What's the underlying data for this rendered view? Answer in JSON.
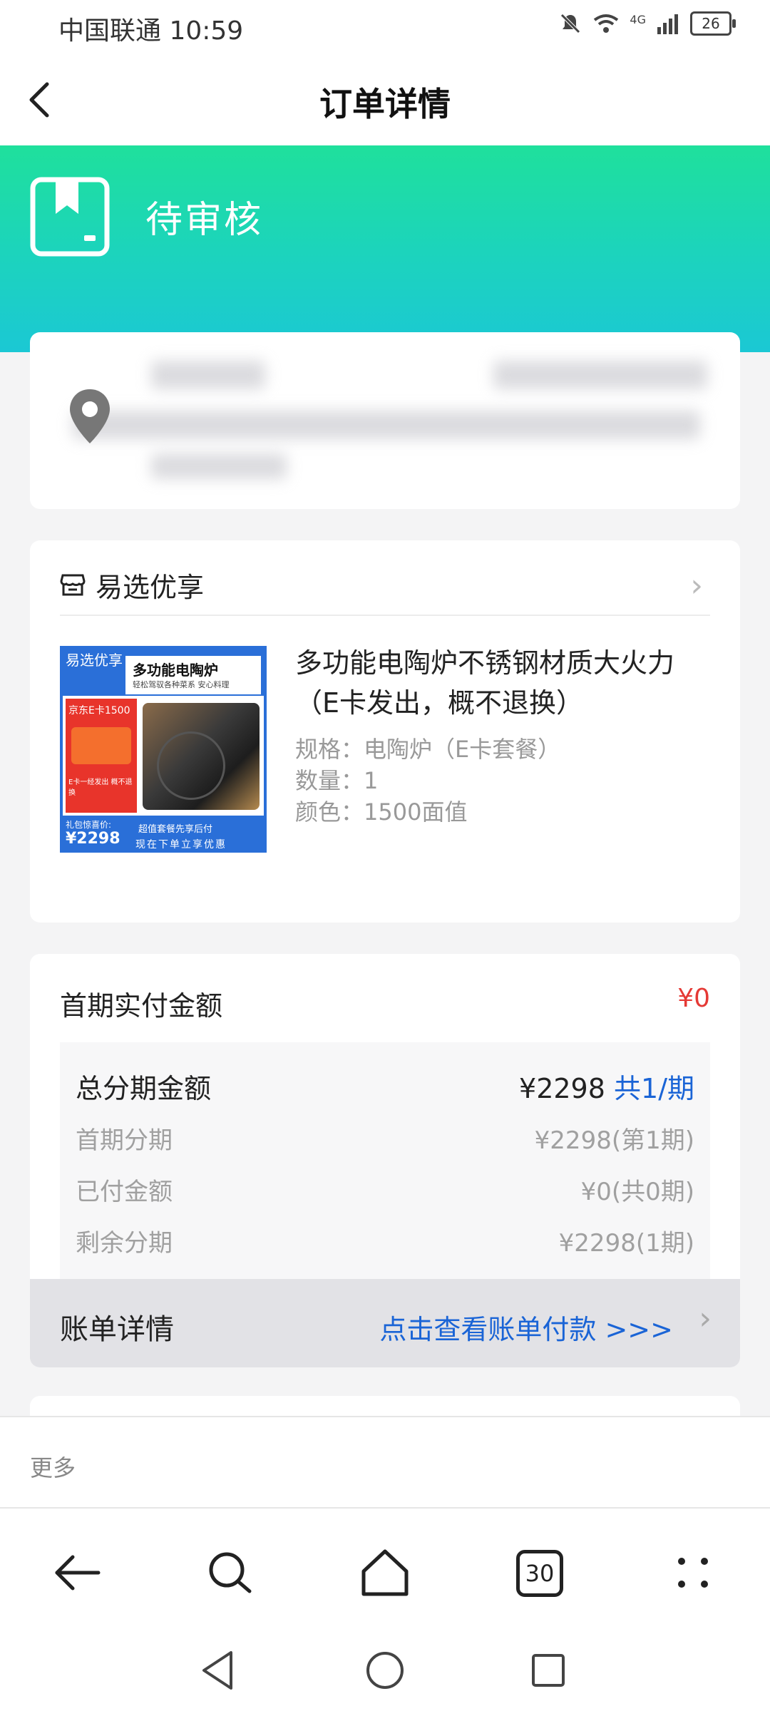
{
  "status_bar": {
    "carrier_time": "中国联通 10:59",
    "battery": "26",
    "network": "4G"
  },
  "header": {
    "title": "订单详情"
  },
  "order": {
    "status": "待审核"
  },
  "store": {
    "name": "易选优享"
  },
  "product": {
    "title": "多功能电陶炉不锈钢材质大火力（E卡发出，概不退换）",
    "spec": "规格：电陶炉（E卡套餐）",
    "quantity": "数量：1",
    "color": "颜色：1500面值",
    "thumb": {
      "brand": "易选优享",
      "headline": "多功能电陶炉",
      "tagline": "轻松驾驭各种菜系 安心料理",
      "card_label": "京东E卡1500",
      "note": "E卡一经发出 概不退换",
      "price_label": "礼包惊喜价:",
      "price": "¥2298",
      "promo1": "超值套餐先享后付",
      "promo2": "现在下单立享优惠"
    }
  },
  "payment": {
    "first_label": "首期实付金额",
    "first_value": "¥0",
    "total_label": "总分期金额",
    "total_value": "¥2298",
    "total_periods": "共1/期",
    "rows": [
      {
        "label": "首期分期",
        "value": "¥2298(第1期)"
      },
      {
        "label": "已付金额",
        "value": "¥0(共0期)"
      },
      {
        "label": "剩余分期",
        "value": "¥2298(1期)"
      }
    ],
    "bill_label": "账单详情",
    "bill_link": "点击查看账单付款 >>>"
  },
  "more": {
    "label": "更多"
  },
  "toolbar": {
    "tab_count": "30"
  },
  "colors": {
    "accent_teal": "#1fdc9f",
    "link_blue": "#1a64d6",
    "price_red": "#e53935"
  }
}
